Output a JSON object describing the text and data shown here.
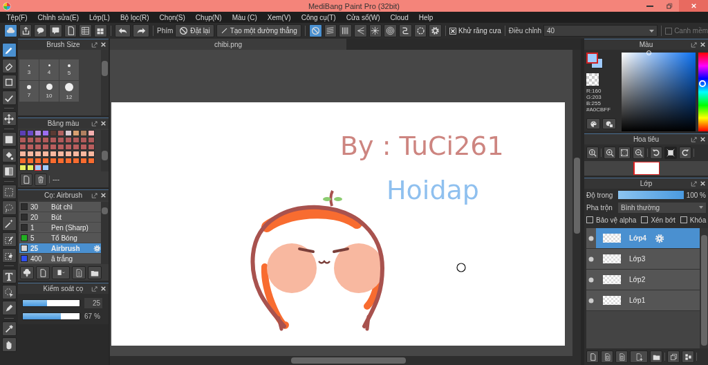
{
  "window": {
    "title": "MediBang Paint Pro (32bit)"
  },
  "menu": [
    "Tệp(F)",
    "Chỉnh sửa(E)",
    "Lớp(L)",
    "Bộ lọc(R)",
    "Chọn(S)",
    "Chụp(N)",
    "Màu (C)",
    "Xem(V)",
    "Công cụ(T)",
    "Cửa sổ(W)",
    "Cloud",
    "Help"
  ],
  "toolbar": {
    "snap_label": "Phím",
    "reset_button": "Đặt lại",
    "line_button": "Tạo một đường thẳng",
    "snap_modes": [
      {
        "selected": true
      },
      {
        "selected": false
      },
      {
        "selected": false
      },
      {
        "selected": false
      },
      {
        "selected": false
      },
      {
        "selected": false
      },
      {
        "selected": false
      },
      {
        "selected": false
      },
      {
        "selected": false
      }
    ],
    "antialias": {
      "label": "Khử răng cưa",
      "checked": true
    },
    "correction": {
      "label": "Điều chỉnh",
      "value": "40"
    },
    "soft_edge": {
      "label": "Canh mềm",
      "checked": false,
      "disabled": true
    }
  },
  "tools": [
    {
      "selected": true
    },
    {
      "selected": false
    },
    {
      "selected": false
    },
    {
      "selected": false
    },
    {
      "selected": false
    },
    {
      "selected": false
    },
    {
      "selected": false
    },
    {
      "selected": false
    },
    {
      "selected": false
    },
    {
      "selected": false
    },
    {
      "selected": false
    },
    {
      "selected": false
    },
    {
      "selected": false
    },
    {
      "selected": false
    },
    {
      "selected": false
    },
    {
      "selected": false
    },
    {
      "selected": false
    },
    {
      "selected": false
    }
  ],
  "brush_size_panel": {
    "title": "Brush Size",
    "sizes": [
      "3",
      "4",
      "5",
      "7",
      "10",
      "12"
    ]
  },
  "palette_panel": {
    "title": "Bảng màu",
    "palette_name": "---",
    "swatches": [
      {
        "color": "#5b3fb5",
        "selected": false
      },
      {
        "color": "#6a4bc8",
        "selected": false
      },
      {
        "color": "#b48ce6",
        "selected": false
      },
      {
        "color": "#9b6ef0",
        "selected": false
      },
      {
        "color": "#5a3a33",
        "selected": false
      },
      {
        "color": "#b0605e",
        "selected": false
      },
      {
        "color": "#d8c8d0",
        "selected": false
      },
      {
        "color": "#d8a070",
        "selected": false
      },
      {
        "color": "#b08060",
        "selected": false
      },
      {
        "color": "#f4b0b0",
        "selected": false
      },
      {
        "color": "#b05a5a",
        "selected": false
      },
      {
        "color": "#b05a5a",
        "selected": false
      },
      {
        "color": "#b05a5a",
        "selected": false
      },
      {
        "color": "#b05a5a",
        "selected": false
      },
      {
        "color": "#b05a5a",
        "selected": false
      },
      {
        "color": "#b05a5a",
        "selected": false
      },
      {
        "color": "#b05a5a",
        "selected": false
      },
      {
        "color": "#b05a5a",
        "selected": false
      },
      {
        "color": "#b05a5a",
        "selected": false
      },
      {
        "color": "#b05a5a",
        "selected": false
      },
      {
        "color": "#b85e5e",
        "selected": false
      },
      {
        "color": "#b85e5e",
        "selected": false
      },
      {
        "color": "#b85e5e",
        "selected": false
      },
      {
        "color": "#b85e5e",
        "selected": false
      },
      {
        "color": "#b85e5e",
        "selected": false
      },
      {
        "color": "#b85e5e",
        "selected": false
      },
      {
        "color": "#b85e5e",
        "selected": false
      },
      {
        "color": "#b85e5e",
        "selected": false
      },
      {
        "color": "#b85e5e",
        "selected": false
      },
      {
        "color": "#b85e5e",
        "selected": false
      },
      {
        "color": "#f8b8a0",
        "selected": false
      },
      {
        "color": "#f8b8a0",
        "selected": false
      },
      {
        "color": "#f8b8a0",
        "selected": false
      },
      {
        "color": "#f8b8a0",
        "selected": false
      },
      {
        "color": "#f8b8a0",
        "selected": false
      },
      {
        "color": "#f8b8a0",
        "selected": false
      },
      {
        "color": "#f8b8a0",
        "selected": false
      },
      {
        "color": "#f8b8a0",
        "selected": false
      },
      {
        "color": "#f8b8a0",
        "selected": false
      },
      {
        "color": "#f8b8a0",
        "selected": false
      },
      {
        "color": "#f86c30",
        "selected": false
      },
      {
        "color": "#f86c30",
        "selected": false
      },
      {
        "color": "#f86c30",
        "selected": false
      },
      {
        "color": "#f86c30",
        "selected": false
      },
      {
        "color": "#f86c30",
        "selected": false
      },
      {
        "color": "#f86c30",
        "selected": false
      },
      {
        "color": "#f86c30",
        "selected": false
      },
      {
        "color": "#f86c30",
        "selected": false
      },
      {
        "color": "#f86c30",
        "selected": false
      },
      {
        "color": "#f86c30",
        "selected": false
      },
      {
        "color": "#e8f060",
        "selected": false
      },
      {
        "color": "#e8f060",
        "selected": false
      },
      {
        "color": "#a0cbff",
        "selected": true
      },
      {
        "color": "#a0cbff",
        "selected": false
      }
    ]
  },
  "brush_panel": {
    "title": "Cọ: Airbrush",
    "brushes": [
      {
        "size": "30",
        "name": "Bút chì",
        "color": "#2e2e2e",
        "selected": false
      },
      {
        "size": "20",
        "name": "Bút",
        "color": "#2e2e2e",
        "selected": false
      },
      {
        "size": "1",
        "name": "Pen (Sharp)",
        "color": "#2e2e2e",
        "selected": false
      },
      {
        "size": "5",
        "name": "Tổ Bóng",
        "color": "#22b022",
        "selected": false
      },
      {
        "size": "25",
        "name": "Airbrush",
        "color": "#d8d8d8",
        "selected": true
      },
      {
        "size": "400",
        "name": "ă trắng",
        "color": "#3050f0",
        "selected": false
      }
    ]
  },
  "brush_control": {
    "title": "Kiểm soát cọ",
    "size": {
      "level": 0.43,
      "value": "25"
    },
    "opacity": {
      "level": 0.67,
      "value": "67 %"
    }
  },
  "canvas": {
    "tab": "chibi.png",
    "texts": [
      "By : TuCi261",
      "Hoidap"
    ]
  },
  "color_panel": {
    "title": "Màu",
    "readout": [
      "R:160",
      "G:203",
      "B:255",
      "#A0CBFF"
    ],
    "hue": {
      "level": 0.62
    }
  },
  "navigator": {
    "title": "Hoa tiêu"
  },
  "layer_panel": {
    "title": "Lớp",
    "opacity": {
      "label": "Độ trong",
      "level": 1,
      "value": "100 %"
    },
    "blend": {
      "label": "Pha trộn",
      "value": "Bình thường"
    },
    "options": [
      {
        "label": "Bảo vệ alpha",
        "checked": false
      },
      {
        "label": "Xén bớt",
        "checked": false
      },
      {
        "label": "Khóa",
        "checked": false
      }
    ],
    "layers": [
      {
        "name": "Lớp4",
        "selected": true
      },
      {
        "name": "Lớp3",
        "selected": false
      },
      {
        "name": "Lớp2",
        "selected": false
      },
      {
        "name": "Lớp1",
        "selected": false
      }
    ]
  }
}
